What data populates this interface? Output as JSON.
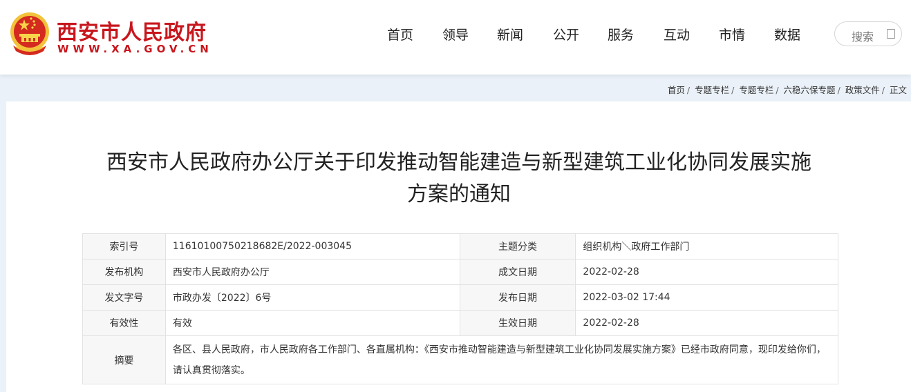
{
  "header": {
    "site_name": "西安市人民政府",
    "site_url": "WWW.XA.GOV.CN",
    "nav": [
      "首页",
      "领导",
      "新闻",
      "公开",
      "服务",
      "互动",
      "市情",
      "数据"
    ],
    "search_placeholder": "搜索",
    "colors": {
      "brand_red": "#c8161d",
      "emblem_gold": "#f2c23a"
    }
  },
  "breadcrumb": [
    "首页",
    "专题专栏",
    "专题专栏",
    "六稳六保专题",
    "政策文件",
    "正文"
  ],
  "document": {
    "title_line1": "西安市人民政府办公厅关于印发推动智能建造与新型建筑工业化协同发展实施",
    "title_line2": "方案的通知",
    "meta": {
      "index_no_label": "索引号",
      "index_no": "11610100750218682E/2022-003045",
      "topic_label": "主题分类",
      "topic": "组织机构＼政府工作部门",
      "issuer_label": "发布机构",
      "issuer": "西安市人民政府办公厅",
      "created_label": "成文日期",
      "created": "2022-02-28",
      "doc_no_label": "发文字号",
      "doc_no": "市政办发〔2022〕6号",
      "published_label": "发布日期",
      "published": "2022-03-02 17:44",
      "validity_label": "有效性",
      "validity": "有效",
      "effective_label": "生效日期",
      "effective": "2022-02-28",
      "summary_label": "摘要",
      "summary": "各区、县人民政府，市人民政府各工作部门、各直属机构：《西安市推动智能建造与新型建筑工业化协同发展实施方案》已经市政府同意，现印发给你们，请认真贯彻落实。"
    }
  }
}
